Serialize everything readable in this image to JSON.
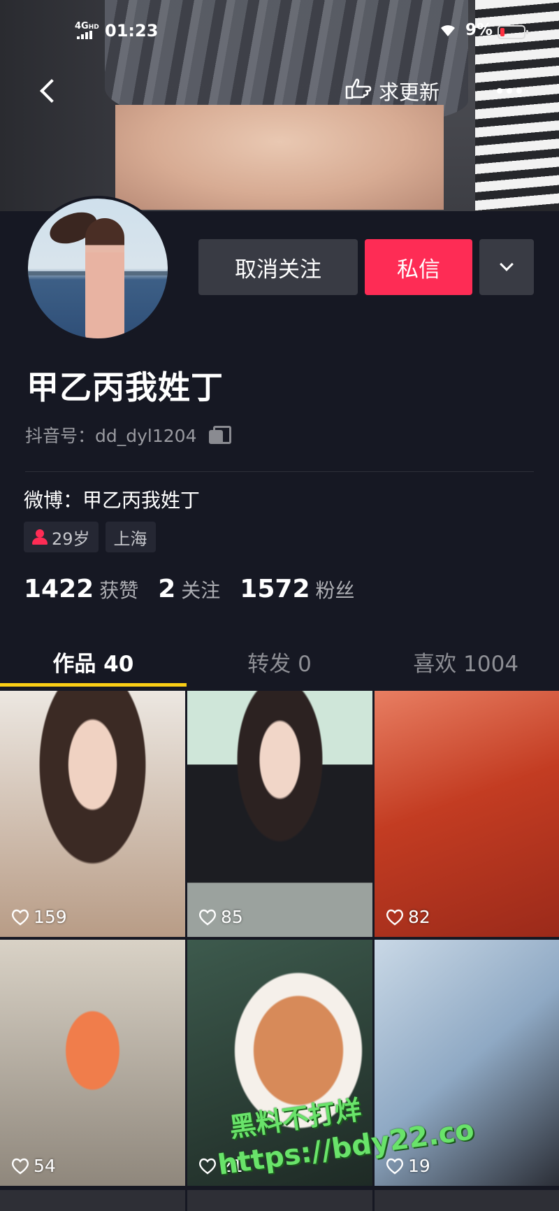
{
  "status_bar": {
    "network": "4G",
    "network_suffix": "HD",
    "time": "01:23",
    "battery_percent": "9%"
  },
  "nav": {
    "update_label": "求更新"
  },
  "profile": {
    "nickname": "甲乙丙我姓丁",
    "douyin_id": "抖音号：dd_dyl1204",
    "weibo": "微博：甲乙丙我姓丁",
    "tags": [
      {
        "label": "29岁"
      },
      {
        "label": "上海"
      }
    ],
    "stats": [
      {
        "value": "1422",
        "label": "获赞"
      },
      {
        "value": "2",
        "label": "关注"
      },
      {
        "value": "1572",
        "label": "粉丝"
      }
    ]
  },
  "actions": {
    "unfollow": "取消关注",
    "message": "私信"
  },
  "tabs": [
    {
      "label": "作品 40",
      "active": true
    },
    {
      "label": "转发 0",
      "active": false
    },
    {
      "label": "喜欢 1004",
      "active": false
    }
  ],
  "videos": [
    {
      "likes": "159"
    },
    {
      "likes": "85"
    },
    {
      "likes": "82"
    },
    {
      "likes": "54"
    },
    {
      "likes": "21"
    },
    {
      "likes": "19"
    }
  ],
  "watermark": {
    "line1": "黑料不打烊",
    "line2": "https://bdy22.co"
  },
  "colors": {
    "background": "#161823",
    "accent": "#fe2c55",
    "tab_indicator": "#face15"
  }
}
